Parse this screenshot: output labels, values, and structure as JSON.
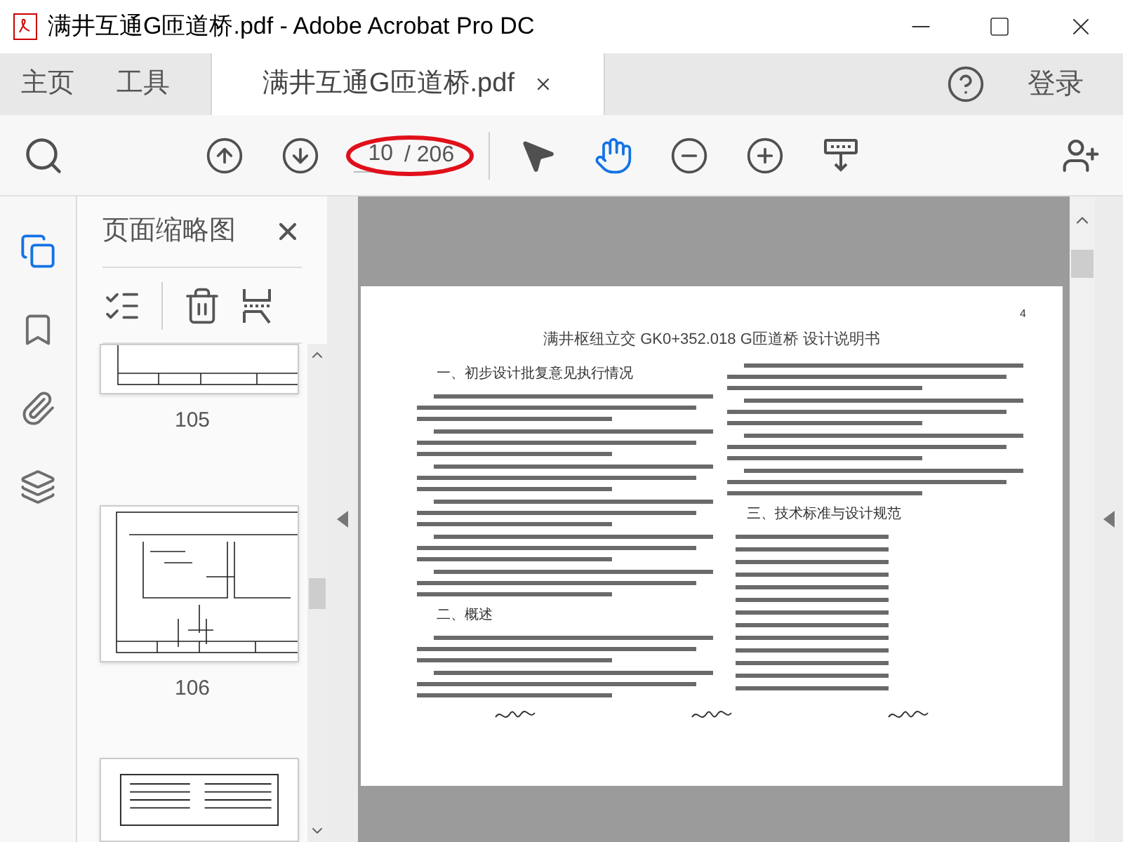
{
  "window": {
    "title": "满井互通G匝道桥.pdf - Adobe Acrobat Pro DC"
  },
  "tabs": [
    {
      "label": "主页",
      "selected": false
    },
    {
      "label": "工具",
      "selected": false
    },
    {
      "label": "满井互通G匝道桥.pdf",
      "selected": true
    }
  ],
  "account": {
    "label": "登录"
  },
  "toolbar": {
    "page_input": "10",
    "page_total": "/ 206",
    "tools": [
      {
        "kind": "select",
        "selected": false
      },
      {
        "kind": "hand",
        "selected": true
      },
      {
        "kind": "zoom_out",
        "selected": false
      },
      {
        "kind": "zoom_in",
        "selected": false
      },
      {
        "kind": "keyboard",
        "selected": false
      }
    ]
  },
  "rail": [
    {
      "kind": "pages",
      "selected": true
    },
    {
      "kind": "bookmarks",
      "selected": false
    },
    {
      "kind": "attachments",
      "selected": false
    },
    {
      "kind": "layers",
      "selected": false
    }
  ],
  "thumbnails_panel": {
    "title": "页面缩略图",
    "pages": [
      {
        "label": "105"
      },
      {
        "label": "106"
      }
    ]
  },
  "document": {
    "page_number": "4",
    "title": "满井枢纽立交 GK0+352.018 G匝道桥 设计说明书",
    "left_column": [
      {
        "kind": "heading",
        "text": "一、初步设计批复意见执行情况"
      },
      {
        "kind": "body"
      },
      {
        "kind": "body"
      },
      {
        "kind": "body"
      },
      {
        "kind": "body"
      },
      {
        "kind": "body"
      },
      {
        "kind": "body"
      },
      {
        "kind": "heading",
        "text": "二、概述"
      },
      {
        "kind": "body"
      },
      {
        "kind": "body"
      }
    ],
    "right_column": [
      {
        "kind": "body"
      },
      {
        "kind": "body"
      },
      {
        "kind": "body"
      },
      {
        "kind": "body"
      },
      {
        "kind": "heading",
        "text": "三、技术标准与设计规范"
      },
      {
        "kind": "list"
      },
      {
        "kind": "list"
      },
      {
        "kind": "list"
      },
      {
        "kind": "list"
      },
      {
        "kind": "list"
      },
      {
        "kind": "list"
      },
      {
        "kind": "list"
      },
      {
        "kind": "list"
      },
      {
        "kind": "list"
      },
      {
        "kind": "list"
      },
      {
        "kind": "list"
      },
      {
        "kind": "list"
      },
      {
        "kind": "list"
      }
    ]
  }
}
